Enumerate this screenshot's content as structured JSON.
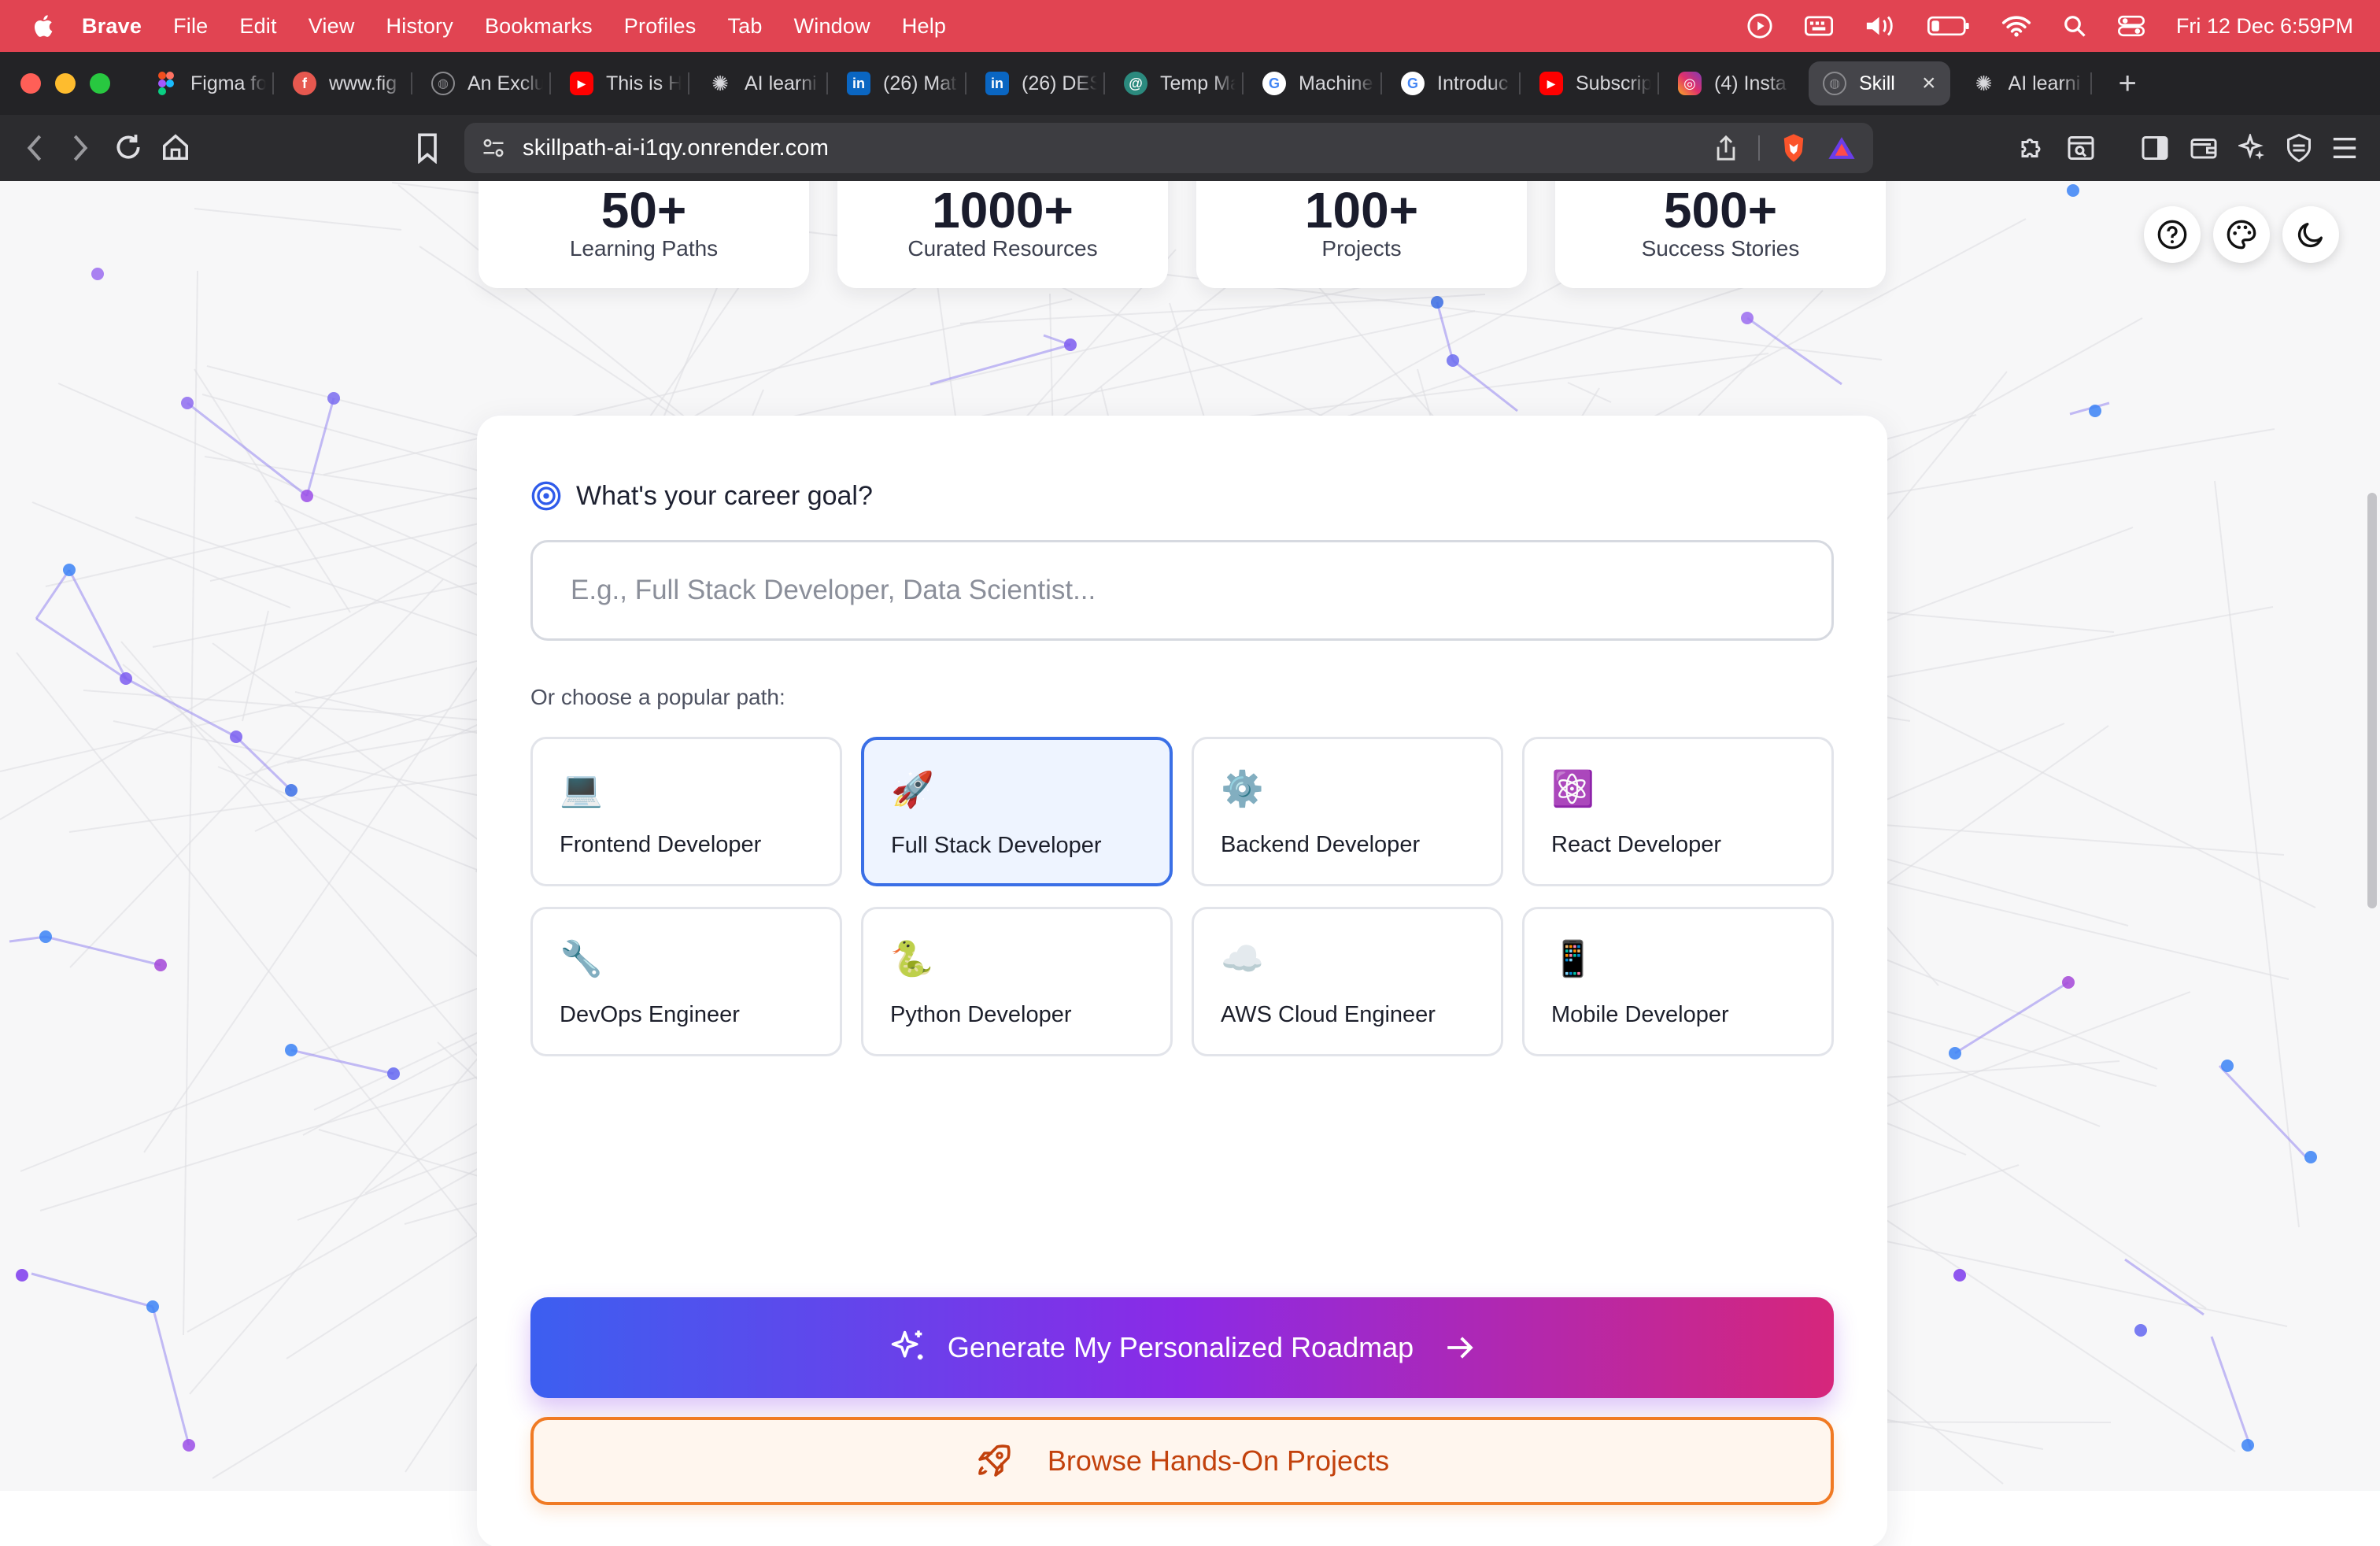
{
  "menubar": {
    "app_name": "Brave",
    "items": [
      "File",
      "Edit",
      "View",
      "History",
      "Bookmarks",
      "Profiles",
      "Tab",
      "Window",
      "Help"
    ],
    "clock": "Fri 12 Dec  6:59PM"
  },
  "tabs": [
    {
      "label": "Figma fo",
      "icon": "figma-icon",
      "color": "#a259ff"
    },
    {
      "label": "www.fig",
      "icon": "figma-circle-icon",
      "color": "#e6584f"
    },
    {
      "label": "An Exclu",
      "icon": "globe-icon",
      "color": "#8a8a8e"
    },
    {
      "label": "This is H",
      "icon": "youtube-icon",
      "color": "#ff0000"
    },
    {
      "label": "AI learni",
      "icon": "openai-icon",
      "color": "#d8d8dc"
    },
    {
      "label": "(26) Mat",
      "icon": "linkedin-icon",
      "color": "#0a66c2"
    },
    {
      "label": "(26) DES",
      "icon": "linkedin-icon",
      "color": "#0a66c2"
    },
    {
      "label": "Temp Ma",
      "icon": "temp-mail-icon",
      "color": "#2b8a7e"
    },
    {
      "label": "Machine",
      "icon": "google-icon",
      "color": "#ffffff"
    },
    {
      "label": "Introduc",
      "icon": "google-icon",
      "color": "#ffffff"
    },
    {
      "label": "Subscrip",
      "icon": "youtube-icon",
      "color": "#ff0000"
    },
    {
      "label": "(4) Insta",
      "icon": "instagram-icon",
      "color": "#e1306c"
    },
    {
      "label": "Skill",
      "icon": "globe-icon",
      "color": "#8a8a8e",
      "active": true
    },
    {
      "label": "AI learni",
      "icon": "openai-icon",
      "color": "#d8d8dc"
    }
  ],
  "address_bar": {
    "url": "skillpath-ai-i1qy.onrender.com"
  },
  "stats": [
    {
      "value": "50+",
      "label": "Learning Paths"
    },
    {
      "value": "1000+",
      "label": "Curated Resources"
    },
    {
      "value": "100+",
      "label": "Projects"
    },
    {
      "value": "500+",
      "label": "Success Stories"
    }
  ],
  "float_buttons": [
    {
      "icon": "help-icon"
    },
    {
      "icon": "palette-icon"
    },
    {
      "icon": "moon-icon"
    }
  ],
  "goal": {
    "heading": "What's your career goal?",
    "placeholder": "E.g., Full Stack Developer, Data Scientist...",
    "value": "",
    "popular_label": "Or choose a popular path:"
  },
  "paths": [
    {
      "emoji": "💻",
      "label": "Frontend Developer",
      "selected": false
    },
    {
      "emoji": "🚀",
      "label": "Full Stack Developer",
      "selected": true
    },
    {
      "emoji": "⚙️",
      "label": "Backend Developer",
      "selected": false
    },
    {
      "emoji": "⚛️",
      "label": "React Developer",
      "selected": false
    },
    {
      "emoji": "🔧",
      "label": "DevOps Engineer",
      "selected": false
    },
    {
      "emoji": "🐍",
      "label": "Python Developer",
      "selected": false
    },
    {
      "emoji": "☁️",
      "label": "AWS Cloud Engineer",
      "selected": false
    },
    {
      "emoji": "📱",
      "label": "Mobile Developer",
      "selected": false
    }
  ],
  "actions": {
    "generate_label": "Generate My Personalized Roadmap",
    "browse_label": "Browse Hands-On Projects"
  },
  "colors": {
    "menubar": "#e14452",
    "accent_blue": "#3a6fe6",
    "gradient_start": "#3c5ff0",
    "gradient_mid": "#8b2ae6",
    "gradient_end": "#d6267b",
    "orange": "#f07a24"
  }
}
